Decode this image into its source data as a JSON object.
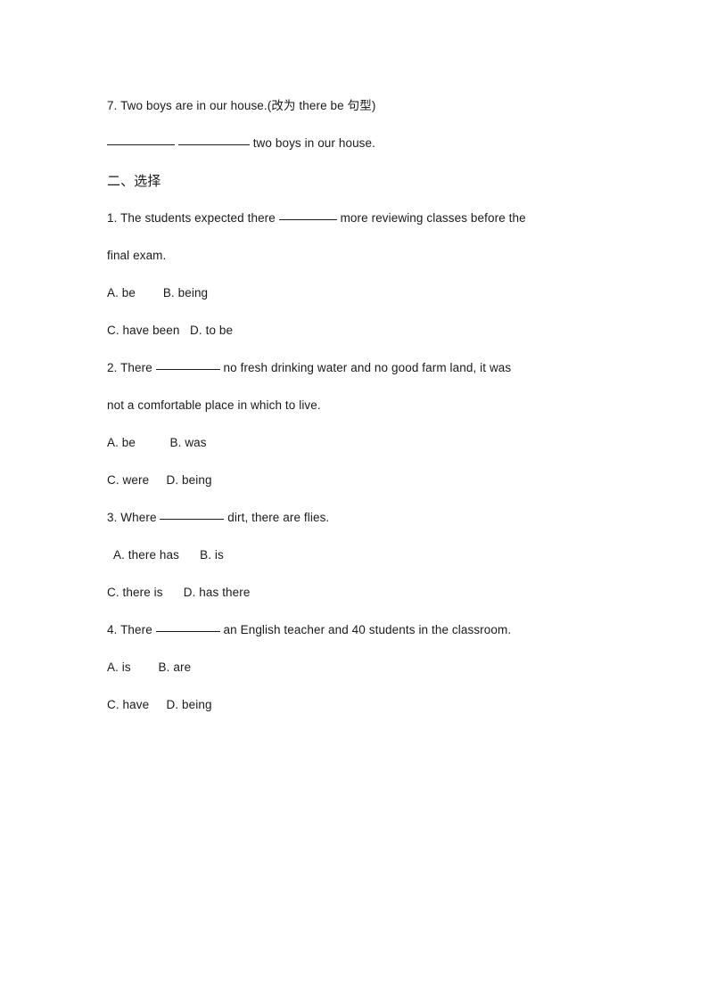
{
  "document": {
    "background_color": "#ffffff",
    "text_color": "#1a1a1a"
  },
  "items": {
    "q7_stem_pre": "7. Two boys are in our house.(",
    "q7_stem_cn1": "改为",
    "q7_stem_mid": " there be ",
    "q7_stem_cn2": "句型",
    "q7_stem_post": ")",
    "q7_answer_tail": " two boys in our house.",
    "section_two_heading": "二、选择",
    "q1_stem_pre": "1. The students expected there ",
    "q1_stem_post": " more reviewing classes before the",
    "q1_stem_line2": "final exam.",
    "q1_opt_ab": "A. be        B. being",
    "q1_opt_cd": "C. have been   D. to be",
    "q2_stem_pre": "2. There ",
    "q2_stem_post": " no fresh drinking water and no good farm land, it was",
    "q2_stem_line2": "not a comfortable place in which to live.",
    "q2_opt_ab": "A. be          B. was",
    "q2_opt_cd": "C. were     D. being",
    "q3_stem_pre": "3. Where ",
    "q3_stem_post": " dirt, there are flies.",
    "q3_opt_ab": "A. there has      B. is",
    "q3_opt_cd": "C. there is      D. has there",
    "q4_stem_pre": "4. There ",
    "q4_stem_post": " an English teacher and 40 students in the classroom.",
    "q4_opt_ab": "A. is        B. are",
    "q4_opt_cd": "C. have     D. being"
  }
}
